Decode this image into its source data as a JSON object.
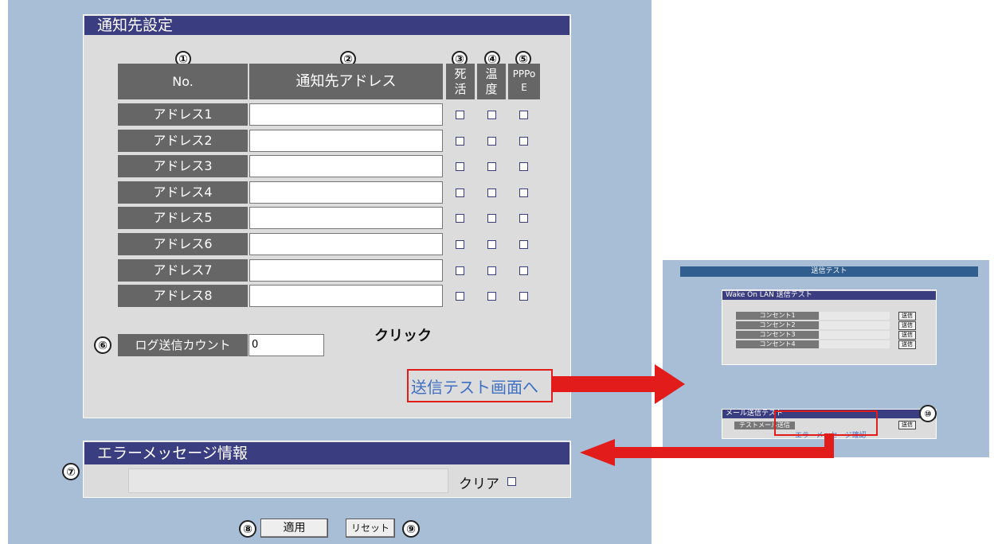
{
  "main": {
    "title": "通知先設定",
    "col_numbers": [
      "①",
      "②",
      "③",
      "④",
      "⑤"
    ],
    "col_no": "No.",
    "col_address": "通知先アドレス",
    "col_alive": "死活",
    "col_temp": "温度",
    "col_pppoe": "PPPoE",
    "rows": [
      {
        "label": "アドレス1",
        "value": ""
      },
      {
        "label": "アドレス2",
        "value": ""
      },
      {
        "label": "アドレス3",
        "value": ""
      },
      {
        "label": "アドレス4",
        "value": ""
      },
      {
        "label": "アドレス5",
        "value": ""
      },
      {
        "label": "アドレス6",
        "value": ""
      },
      {
        "label": "アドレス7",
        "value": ""
      },
      {
        "label": "アドレス8",
        "value": ""
      }
    ],
    "log_marker": "⑥",
    "log_label": "ログ送信カウント",
    "log_value": "0",
    "click_label": "クリック",
    "test_link": "送信テスト画面へ"
  },
  "error": {
    "marker": "⑦",
    "title": "エラーメッセージ情報",
    "clear_label": "クリア"
  },
  "footer": {
    "apply_marker": "⑧",
    "apply_label": "適用",
    "reset_label": "リセット",
    "reset_marker": "⑨"
  },
  "preview": {
    "title": "送信テスト",
    "wol_title": "Wake On LAN 送信テスト",
    "wol_rows": [
      "コンセント1",
      "コンセント2",
      "コンセント3",
      "コンセント4"
    ],
    "send_label": "送信",
    "mail_title": "メール送信テスト",
    "mail_label": "テストメール送信",
    "mail_send": "送信",
    "mail_marker": "⑩",
    "error_link": "エラーメッセージ確認"
  },
  "colors": {
    "panel_bg": "#a7bed6",
    "header_bg": "#3a3e80",
    "highlight": "#e21b1b"
  }
}
